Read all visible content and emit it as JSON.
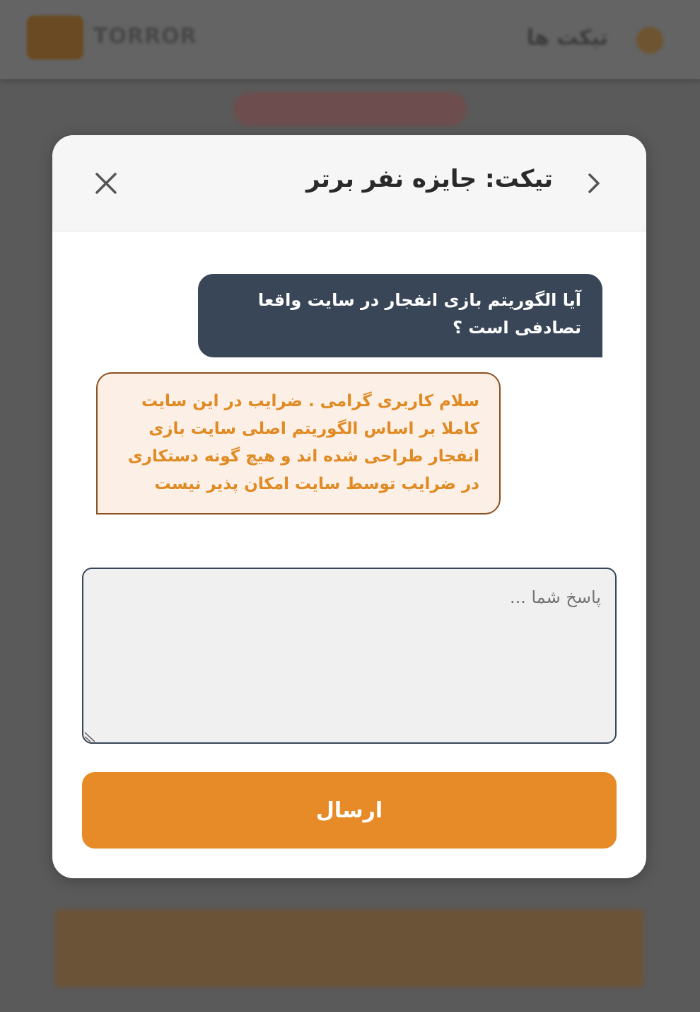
{
  "background": {
    "logo_text": "TORROR",
    "header_title": "تیکت ها"
  },
  "modal": {
    "title": "تیکت: جایزه نفر برتر",
    "back_icon": "chevron-right-icon",
    "close_icon": "close-icon"
  },
  "messages": [
    {
      "sender": "user",
      "text": "آیا الگوریتم بازی انفجار در سایت واقعا تصادفی است ؟"
    },
    {
      "sender": "support",
      "text": "سلام کاربری گرامی . ضرایب در این سایت کاملا بر اساس الگوریتم اصلی سایت بازی انفجار طراحی شده اند و هیچ گونه دستکاری در ضرایب توسط سایت امکان پذیر نیست"
    }
  ],
  "reply": {
    "placeholder": "پاسخ شما ...",
    "value": ""
  },
  "send_button": {
    "label": "ارسال"
  },
  "colors": {
    "overlay": "#5a5a5a",
    "user_bubble": "#394658",
    "support_bubble_bg": "#fcefe5",
    "support_text": "#e08a23",
    "accent": "#e68b27"
  }
}
